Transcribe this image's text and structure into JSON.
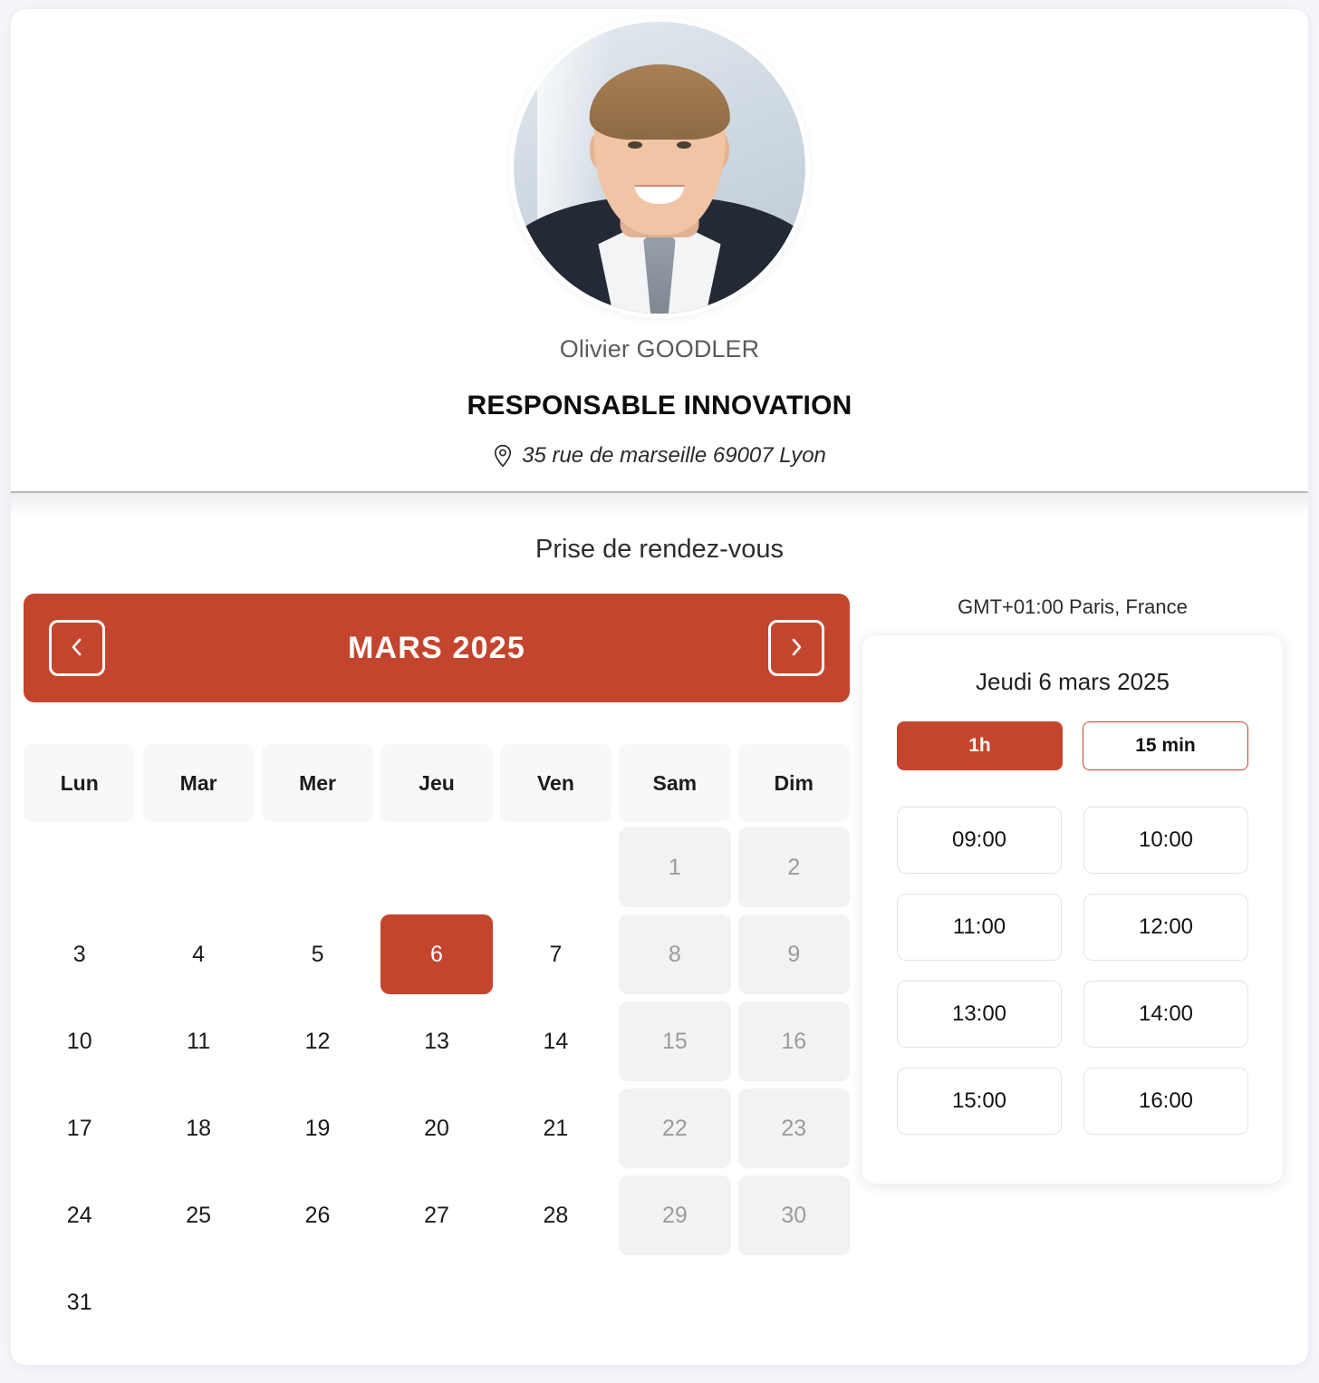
{
  "theme": {
    "accent": "#c4452e",
    "page_bg": "#f4f5f9",
    "card_bg": "#ffffff",
    "weekend_bg": "#f2f2f3",
    "dow_bg": "#f7f8fa"
  },
  "profile": {
    "name": "Olivier GOODLER",
    "role": "RESPONSABLE INNOVATION",
    "address": "35 rue de marseille 69007 Lyon",
    "address_icon": "location-pin-icon",
    "avatar_alt": "Olivier GOODLER"
  },
  "booking": {
    "title": "Prise de rendez-vous"
  },
  "calendar": {
    "month_label": "MARS 2025",
    "prev_icon": "chevron-left-icon",
    "next_icon": "chevron-right-icon",
    "day_headers": [
      "Lun",
      "Mar",
      "Mer",
      "Jeu",
      "Ven",
      "Sam",
      "Dim"
    ],
    "leading_blanks": 5,
    "selected_day": 6,
    "weekend_columns": [
      5,
      6
    ],
    "days": [
      1,
      2,
      3,
      4,
      5,
      6,
      7,
      8,
      9,
      10,
      11,
      12,
      13,
      14,
      15,
      16,
      17,
      18,
      19,
      20,
      21,
      22,
      23,
      24,
      25,
      26,
      27,
      28,
      29,
      30,
      31
    ]
  },
  "slots_panel": {
    "timezone": "GMT+01:00 Paris, France",
    "selected_date": "Jeudi 6 mars 2025",
    "durations": [
      {
        "label": "1h",
        "selected": true
      },
      {
        "label": "15 min",
        "selected": false
      }
    ],
    "times": [
      "09:00",
      "10:00",
      "11:00",
      "12:00",
      "13:00",
      "14:00",
      "15:00",
      "16:00"
    ]
  }
}
